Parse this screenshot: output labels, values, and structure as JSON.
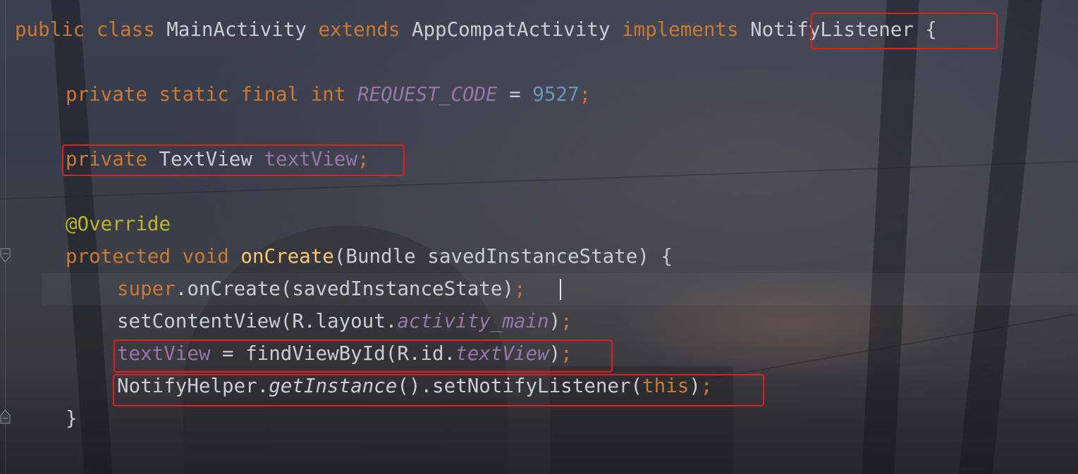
{
  "editor": {
    "lines": [
      {
        "id": "class-decl",
        "tokens": [
          {
            "t": "public ",
            "c": "kw"
          },
          {
            "t": "class ",
            "c": "kw"
          },
          {
            "t": "MainActivity ",
            "c": "plain"
          },
          {
            "t": "extends ",
            "c": "kw"
          },
          {
            "t": "AppCompatActivity ",
            "c": "plain"
          },
          {
            "t": "implements ",
            "c": "kw"
          },
          {
            "t": "NotifyListener",
            "c": "plain"
          },
          {
            "t": " {",
            "c": "plain"
          }
        ]
      },
      {
        "id": "request-code",
        "tokens": [
          {
            "t": "private ",
            "c": "kw"
          },
          {
            "t": "static ",
            "c": "kw"
          },
          {
            "t": "final ",
            "c": "kw"
          },
          {
            "t": "int ",
            "c": "kw"
          },
          {
            "t": "REQUEST_CODE",
            "c": "const"
          },
          {
            "t": " = ",
            "c": "plain"
          },
          {
            "t": "9527",
            "c": "num"
          },
          {
            "t": ";",
            "c": "punc"
          }
        ]
      },
      {
        "id": "textview-field",
        "tokens": [
          {
            "t": "private ",
            "c": "kw"
          },
          {
            "t": "TextView ",
            "c": "plain"
          },
          {
            "t": "textView",
            "c": "field"
          },
          {
            "t": ";",
            "c": "punc"
          }
        ]
      },
      {
        "id": "override-annotation",
        "tokens": [
          {
            "t": "@Override",
            "c": "ann"
          }
        ]
      },
      {
        "id": "oncreate-decl",
        "tokens": [
          {
            "t": "protected ",
            "c": "kw"
          },
          {
            "t": "void ",
            "c": "kw"
          },
          {
            "t": "onCreate",
            "c": "fn"
          },
          {
            "t": "(Bundle savedInstanceState) {",
            "c": "plain"
          }
        ]
      },
      {
        "id": "super-call",
        "tokens": [
          {
            "t": "super",
            "c": "kw"
          },
          {
            "t": ".onCreate(savedInstanceState)",
            "c": "plain"
          },
          {
            "t": ";",
            "c": "punc"
          }
        ]
      },
      {
        "id": "set-content-view",
        "tokens": [
          {
            "t": "setContentView(R.layout.",
            "c": "plain"
          },
          {
            "t": "activity_main",
            "c": "field-ital"
          },
          {
            "t": ")",
            "c": "plain"
          },
          {
            "t": ";",
            "c": "punc"
          }
        ]
      },
      {
        "id": "find-view",
        "tokens": [
          {
            "t": "textView",
            "c": "field"
          },
          {
            "t": " = findViewById(R.id.",
            "c": "plain"
          },
          {
            "t": "textView",
            "c": "field-ital"
          },
          {
            "t": ")",
            "c": "plain"
          },
          {
            "t": ";",
            "c": "punc"
          }
        ]
      },
      {
        "id": "set-notify-listener",
        "tokens": [
          {
            "t": "NotifyHelper.",
            "c": "plain"
          },
          {
            "t": "getInstance",
            "c": "ital"
          },
          {
            "t": "().setNotifyListener(",
            "c": "plain"
          },
          {
            "t": "this",
            "c": "kw"
          },
          {
            "t": ")",
            "c": "plain"
          },
          {
            "t": ";",
            "c": "punc"
          }
        ]
      },
      {
        "id": "close-brace",
        "tokens": [
          {
            "t": "}",
            "c": "plain"
          }
        ]
      }
    ]
  },
  "colors": {
    "keyword": "#cc7832",
    "annotation": "#bbb529",
    "method_declaration": "#ffc66d",
    "number": "#6897bb",
    "field": "#9876aa",
    "text": "#c9ccd4",
    "highlight_box": "#e02020"
  },
  "icons": {
    "fold_open": "fold-open-icon",
    "fold_close": "fold-close-icon"
  }
}
